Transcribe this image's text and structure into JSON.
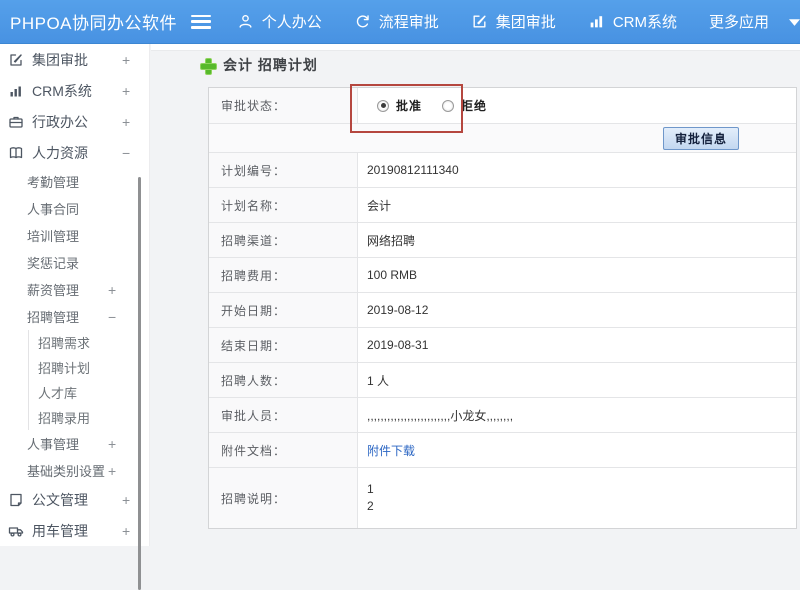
{
  "topbar": {
    "brand": "PHPOA协同办公软件",
    "nav": [
      {
        "label": "个人办公",
        "icon": "user-icon"
      },
      {
        "label": "流程审批",
        "icon": "process-icon"
      },
      {
        "label": "集团审批",
        "icon": "edit-icon"
      },
      {
        "label": "CRM系统",
        "icon": "chart-icon"
      },
      {
        "label": "更多应用",
        "icon": "caret-down-icon"
      }
    ]
  },
  "sidebar": {
    "items": [
      {
        "label": "集团审批",
        "level": 1,
        "icon": "edit-square-icon",
        "expander": "+"
      },
      {
        "label": "CRM系统",
        "level": 1,
        "icon": "bar-chart-icon",
        "expander": "+"
      },
      {
        "label": "行政办公",
        "level": 1,
        "icon": "briefcase-icon",
        "expander": "+"
      },
      {
        "label": "人力资源",
        "level": 1,
        "icon": "book-icon",
        "expander": "−"
      },
      {
        "label": "考勤管理",
        "level": 2
      },
      {
        "label": "人事合同",
        "level": 2
      },
      {
        "label": "培训管理",
        "level": 2
      },
      {
        "label": "奖惩记录",
        "level": 2
      },
      {
        "label": "薪资管理",
        "level": 2,
        "expander": "+"
      },
      {
        "label": "招聘管理",
        "level": 2,
        "expander": "−"
      },
      {
        "label": "招聘需求",
        "level": 3
      },
      {
        "label": "招聘计划",
        "level": 3
      },
      {
        "label": "人才库",
        "level": 3
      },
      {
        "label": "招聘录用",
        "level": 3
      },
      {
        "label": "人事管理",
        "level": 2,
        "expander": "+"
      },
      {
        "label": "基础类别设置",
        "level": 2,
        "expander": "+"
      },
      {
        "label": "公文管理",
        "level": 1,
        "icon": "document-icon",
        "expander": "+"
      },
      {
        "label": "用车管理",
        "level": 1,
        "icon": "truck-icon",
        "expander": "+"
      }
    ]
  },
  "main": {
    "title": "会计 招聘计划",
    "approval": {
      "status_label": "审批状态：",
      "options": [
        {
          "label": "批准",
          "selected": true
        },
        {
          "label": "拒绝",
          "selected": false
        }
      ],
      "button_label": "审批信息"
    },
    "fields": [
      {
        "label": "计划编号：",
        "value": "20190812111340"
      },
      {
        "label": "计划名称：",
        "value": "会计"
      },
      {
        "label": "招聘渠道：",
        "value": "网络招聘"
      },
      {
        "label": "招聘费用：",
        "value": "100 RMB"
      },
      {
        "label": "开始日期：",
        "value": "2019-08-12"
      },
      {
        "label": "结束日期：",
        "value": "2019-08-31"
      },
      {
        "label": "招聘人数：",
        "value": "1 人"
      },
      {
        "label": "审批人员：",
        "value": ",,,,,,,,,,,,,,,,,,,,,,,,,小龙女,,,,,,,,"
      },
      {
        "label": "附件文档：",
        "value": "附件下载",
        "link": true
      },
      {
        "label": "招聘说明：",
        "value_lines": [
          "1",
          "2"
        ]
      }
    ],
    "colors": {
      "topbar_blue": "#4892e2",
      "annotation_red": "#b5473f",
      "link_blue": "#2b66c3",
      "accent_green": "#57b92c"
    }
  }
}
